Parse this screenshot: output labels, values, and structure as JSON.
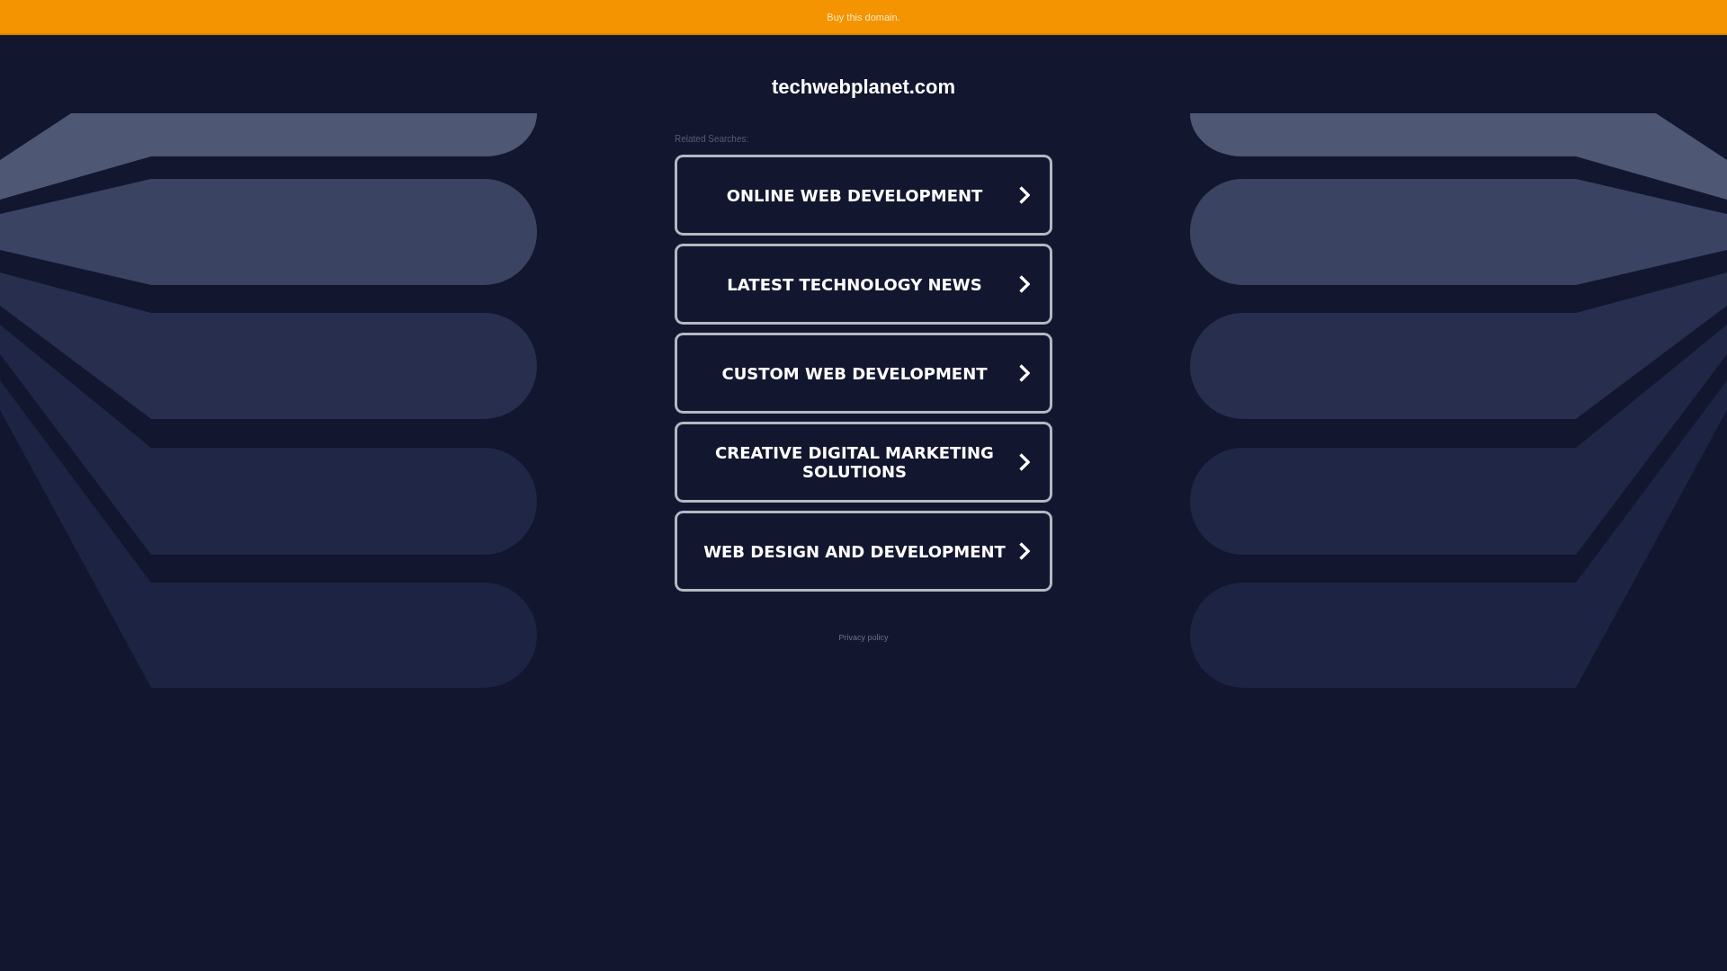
{
  "top_bar": {
    "link": "Buy this domain."
  },
  "site_title": "techwebplanet.com",
  "related_searches": {
    "heading": "Related Searches:",
    "links": [
      "ONLINE WEB DEVELOPMENT",
      "LATEST TECHNOLOGY NEWS",
      "CUSTOM WEB DEVELOPMENT",
      "CREATIVE DIGITAL MARKETING SOLUTIONS",
      "WEB DESIGN AND DEVELOPMENT"
    ]
  },
  "footer": {
    "privacy_link": "Privacy policy"
  }
}
